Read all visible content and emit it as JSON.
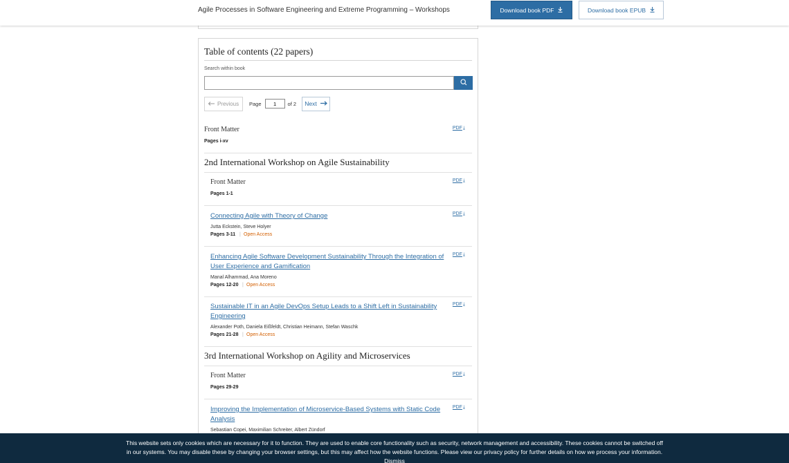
{
  "header": {
    "book_title": "Agile Processes in Software Engineering and Extreme Programming – Workshops",
    "download_pdf_label": "Download book PDF",
    "download_epub_label": "Download book EPUB"
  },
  "toc": {
    "heading": "Table of contents (22 papers)",
    "search_label": "Search within book",
    "search_placeholder": "",
    "pager": {
      "previous_label": "Previous",
      "page_label": "Page",
      "page_value": "1",
      "of_label": "of 2",
      "next_label": "Next"
    },
    "pdf_label": "PDF",
    "front_matter": {
      "title": "Front Matter",
      "pages": "Pages i-xv"
    },
    "sections": [
      {
        "heading": "2nd International Workshop on Agile Sustainability",
        "items": [
          {
            "title": "Front Matter",
            "pages": "Pages 1-1"
          },
          {
            "title": "Connecting Agile with Theory of Change",
            "authors": "Jutta Eckstein, Steve Holyer",
            "pages": "Pages 3-11",
            "access": "Open Access"
          },
          {
            "title": "Enhancing Agile Software Development Sustainability Through the Integration of User Experience and Gamification",
            "authors": "Manal Alhammad, Ana Moreno",
            "pages": "Pages 12-20",
            "access": "Open Access"
          },
          {
            "title": "Sustainable IT in an Agile DevOps Setup Leads to a Shift Left in Sustainability Engineering",
            "authors": "Alexander Poth, Daniela Eißfeldt, Christian Heimann, Stefan Waschk",
            "pages": "Pages 21-28",
            "access": "Open Access"
          }
        ]
      },
      {
        "heading": "3rd International Workshop on Agility and Microservices",
        "items": [
          {
            "title": "Front Matter",
            "pages": "Pages 29-29"
          },
          {
            "title": "Improving the Implementation of Microservice-Based Systems with Static Code Analysis",
            "authors": "Sebastian Copei, Maximilian Schreiter, Albert Zündorf"
          }
        ]
      }
    ]
  },
  "cookie_banner": {
    "text": "This website sets only cookies which are necessary for it to function. They are used to enable core functionality such as security, network management and accessibility. These cookies cannot be switched off in our systems. You may disable these by changing your browser settings, but this may affect how the website functions. Please view our privacy policy for further details on how we process your information.",
    "dismiss_label": "Dismiss"
  },
  "icons": {
    "download": "download-arrow-icon",
    "search": "search-icon",
    "arrow_left": "arrow-left-icon",
    "arrow_right": "arrow-right-icon"
  },
  "colors": {
    "accent": "#2d6da4",
    "open_access": "#d35f00",
    "cookie_bg": "#0f2a3f"
  }
}
